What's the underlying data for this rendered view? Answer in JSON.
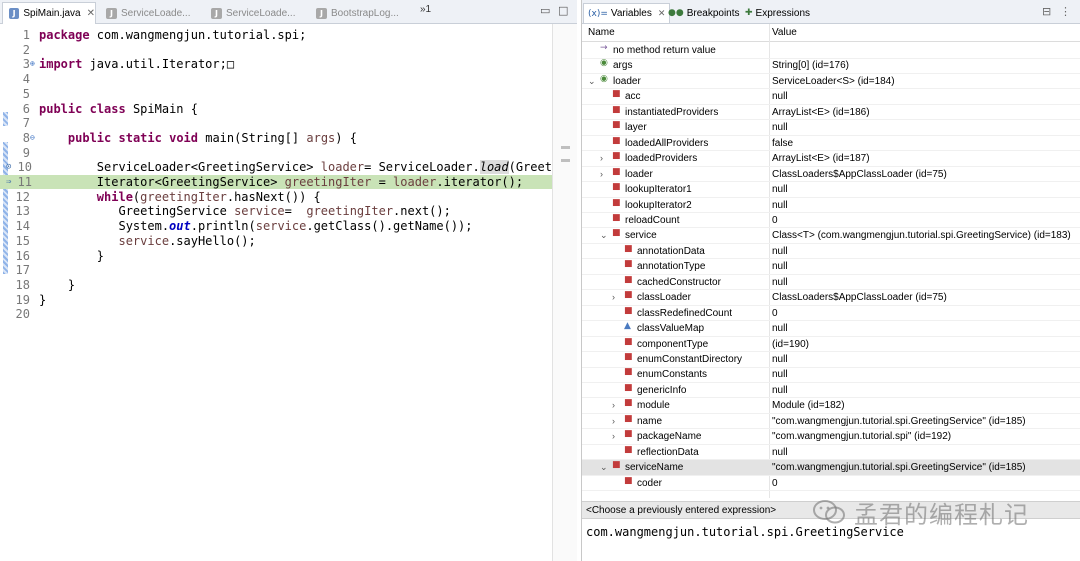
{
  "editor": {
    "tabs": [
      {
        "label": "SpiMain.java",
        "active": true,
        "close": "✕"
      },
      {
        "label": "ServiceLoade...",
        "active": false
      },
      {
        "label": "ServiceLoade...",
        "active": false
      },
      {
        "label": "BootstrapLog...",
        "active": false
      }
    ],
    "tab_overflow": "»1",
    "lines": [
      {
        "n": "1",
        "tokens": [
          {
            "t": "package",
            "c": "kw"
          },
          {
            "t": " com.wangmengjun.tutorial.spi;"
          }
        ]
      },
      {
        "n": "2",
        "tokens": []
      },
      {
        "n": "3",
        "fold": "⊕",
        "tokens": [
          {
            "t": "import",
            "c": "kw"
          },
          {
            "t": " java.util.Iterator;"
          },
          {
            "t": "□"
          }
        ]
      },
      {
        "n": "4",
        "tokens": []
      },
      {
        "n": "5",
        "tokens": []
      },
      {
        "n": "6",
        "tokens": [
          {
            "t": "public",
            "c": "kw"
          },
          {
            "t": " "
          },
          {
            "t": "class",
            "c": "kw"
          },
          {
            "t": " SpiMain {"
          }
        ]
      },
      {
        "n": "7",
        "tokens": []
      },
      {
        "n": "8",
        "fold": "⊖",
        "tokens": [
          {
            "t": "    "
          },
          {
            "t": "public",
            "c": "kw"
          },
          {
            "t": " "
          },
          {
            "t": "static",
            "c": "kw"
          },
          {
            "t": " "
          },
          {
            "t": "void",
            "c": "kw"
          },
          {
            "t": " main(String[] "
          },
          {
            "t": "args",
            "c": "var"
          },
          {
            "t": ") {"
          }
        ]
      },
      {
        "n": "9",
        "tokens": []
      },
      {
        "n": "10",
        "mark": "⊙",
        "tokens": [
          {
            "t": "        ServiceLoader<GreetingService> "
          },
          {
            "t": "loader",
            "c": "var"
          },
          {
            "t": "= ServiceLoader."
          },
          {
            "t": "load",
            "c": "it sel"
          },
          {
            "t": "(Greet:"
          }
        ]
      },
      {
        "n": "11",
        "mark": "⇒",
        "hl": true,
        "tokens": [
          {
            "t": "        Iterator<GreetingService> "
          },
          {
            "t": "greetingIter",
            "c": "var"
          },
          {
            "t": " = "
          },
          {
            "t": "loader",
            "c": "var"
          },
          {
            "t": ".iterator();"
          }
        ]
      },
      {
        "n": "12",
        "tokens": [
          {
            "t": "        "
          },
          {
            "t": "while",
            "c": "kw"
          },
          {
            "t": "("
          },
          {
            "t": "greetingIter",
            "c": "var"
          },
          {
            "t": ".hasNext()) {"
          }
        ]
      },
      {
        "n": "13",
        "tokens": [
          {
            "t": "           GreetingService "
          },
          {
            "t": "service",
            "c": "var"
          },
          {
            "t": "=  "
          },
          {
            "t": "greetingIter",
            "c": "var"
          },
          {
            "t": ".next();"
          }
        ]
      },
      {
        "n": "14",
        "tokens": [
          {
            "t": "           System."
          },
          {
            "t": "out",
            "c": "fld"
          },
          {
            "t": ".println("
          },
          {
            "t": "service",
            "c": "var"
          },
          {
            "t": ".getClass().getName());"
          }
        ]
      },
      {
        "n": "15",
        "tokens": [
          {
            "t": "           "
          },
          {
            "t": "service",
            "c": "var"
          },
          {
            "t": ".sayHello();"
          }
        ]
      },
      {
        "n": "16",
        "tokens": [
          {
            "t": "        }"
          }
        ]
      },
      {
        "n": "17",
        "tokens": []
      },
      {
        "n": "18",
        "tokens": [
          {
            "t": "    }"
          }
        ]
      },
      {
        "n": "19",
        "tokens": [
          {
            "t": "}"
          }
        ]
      },
      {
        "n": "20",
        "tokens": []
      }
    ]
  },
  "variables_view": {
    "tabs": [
      {
        "icon": "(x)=",
        "label": "Variables",
        "active": true,
        "close": "✕"
      },
      {
        "icon": "●●",
        "label": "Breakpoints",
        "active": false
      },
      {
        "icon": "✚",
        "label": "Expressions",
        "active": false
      }
    ],
    "columns": {
      "name": "Name",
      "value": "Value"
    },
    "rows": [
      {
        "indent": 0,
        "twisty": "",
        "icon": "→",
        "icon_color": "#7a5a9a",
        "name": "no method return value",
        "value": ""
      },
      {
        "indent": 0,
        "twisty": "",
        "icon": "◉",
        "icon_color": "#4a8a3a",
        "name": "args",
        "value": "String[0]  (id=176)"
      },
      {
        "indent": 0,
        "twisty": "⌄",
        "icon": "◉",
        "icon_color": "#4a8a3a",
        "name": "loader",
        "value": "ServiceLoader<S>  (id=184)"
      },
      {
        "indent": 1,
        "twisty": "",
        "icon": "■",
        "icon_color": "#c23b3b",
        "name": "acc",
        "value": "null"
      },
      {
        "indent": 1,
        "twisty": "",
        "icon": "■",
        "icon_color": "#c23b3b",
        "name": "instantiatedProviders",
        "value": "ArrayList<E>  (id=186)"
      },
      {
        "indent": 1,
        "twisty": "",
        "icon": "■",
        "icon_color": "#c23b3b",
        "name": "layer",
        "value": "null"
      },
      {
        "indent": 1,
        "twisty": "",
        "icon": "■",
        "icon_color": "#c23b3b",
        "name": "loadedAllProviders",
        "value": "false"
      },
      {
        "indent": 1,
        "twisty": "›",
        "icon": "■",
        "icon_color": "#c23b3b",
        "name": "loadedProviders",
        "value": "ArrayList<E>  (id=187)"
      },
      {
        "indent": 1,
        "twisty": "›",
        "icon": "■",
        "icon_color": "#c23b3b",
        "name": "loader",
        "value": "ClassLoaders$AppClassLoader  (id=75)"
      },
      {
        "indent": 1,
        "twisty": "",
        "icon": "■",
        "icon_color": "#c23b3b",
        "name": "lookupIterator1",
        "value": "null"
      },
      {
        "indent": 1,
        "twisty": "",
        "icon": "■",
        "icon_color": "#c23b3b",
        "name": "lookupIterator2",
        "value": "null"
      },
      {
        "indent": 1,
        "twisty": "",
        "icon": "■",
        "icon_color": "#c23b3b",
        "name": "reloadCount",
        "value": "0"
      },
      {
        "indent": 1,
        "twisty": "⌄",
        "icon": "■",
        "icon_color": "#c23b3b",
        "name": "service",
        "value": "Class<T> (com.wangmengjun.tutorial.spi.GreetingService) (id=183)"
      },
      {
        "indent": 2,
        "twisty": "",
        "icon": "■",
        "icon_color": "#c23b3b",
        "name": "annotationData",
        "value": "null"
      },
      {
        "indent": 2,
        "twisty": "",
        "icon": "■",
        "icon_color": "#c23b3b",
        "name": "annotationType",
        "value": "null"
      },
      {
        "indent": 2,
        "twisty": "",
        "icon": "■",
        "icon_color": "#c23b3b",
        "name": "cachedConstructor",
        "value": "null"
      },
      {
        "indent": 2,
        "twisty": "›",
        "icon": "■",
        "icon_color": "#c23b3b",
        "name": "classLoader",
        "value": "ClassLoaders$AppClassLoader  (id=75)"
      },
      {
        "indent": 2,
        "twisty": "",
        "icon": "■",
        "icon_color": "#c23b3b",
        "name": "classRedefinedCount",
        "value": "0"
      },
      {
        "indent": 2,
        "twisty": "",
        "icon": "▲",
        "icon_color": "#4a7ac0",
        "name": "classValueMap",
        "value": "null"
      },
      {
        "indent": 2,
        "twisty": "",
        "icon": "■",
        "icon_color": "#c23b3b",
        "name": "componentType",
        "value": "(id=190)"
      },
      {
        "indent": 2,
        "twisty": "",
        "icon": "■",
        "icon_color": "#c23b3b",
        "name": "enumConstantDirectory",
        "value": "null"
      },
      {
        "indent": 2,
        "twisty": "",
        "icon": "■",
        "icon_color": "#c23b3b",
        "name": "enumConstants",
        "value": "null"
      },
      {
        "indent": 2,
        "twisty": "",
        "icon": "■",
        "icon_color": "#c23b3b",
        "name": "genericInfo",
        "value": "null"
      },
      {
        "indent": 2,
        "twisty": "›",
        "icon": "■",
        "icon_color": "#c23b3b",
        "name": "module",
        "value": "Module  (id=182)"
      },
      {
        "indent": 2,
        "twisty": "›",
        "icon": "■",
        "icon_color": "#c23b3b",
        "name": "name",
        "value": "\"com.wangmengjun.tutorial.spi.GreetingService\" (id=185)"
      },
      {
        "indent": 2,
        "twisty": "›",
        "icon": "■",
        "icon_color": "#c23b3b",
        "name": "packageName",
        "value": "\"com.wangmengjun.tutorial.spi\" (id=192)"
      },
      {
        "indent": 2,
        "twisty": "",
        "icon": "■",
        "icon_color": "#c23b3b",
        "name": "reflectionData",
        "value": "null"
      },
      {
        "indent": 1,
        "twisty": "⌄",
        "icon": "■",
        "icon_color": "#c23b3b",
        "name": "serviceName",
        "value": "\"com.wangmengjun.tutorial.spi.GreetingService\" (id=185)",
        "selected": true
      },
      {
        "indent": 2,
        "twisty": "",
        "icon": "■",
        "icon_color": "#c23b3b",
        "name": "coder",
        "value": "0"
      }
    ],
    "expression_placeholder": "<Choose a previously entered expression>",
    "detail_text": "com.wangmengjun.tutorial.spi.GreetingService"
  },
  "watermark": {
    "text": "孟君的编程札记"
  }
}
